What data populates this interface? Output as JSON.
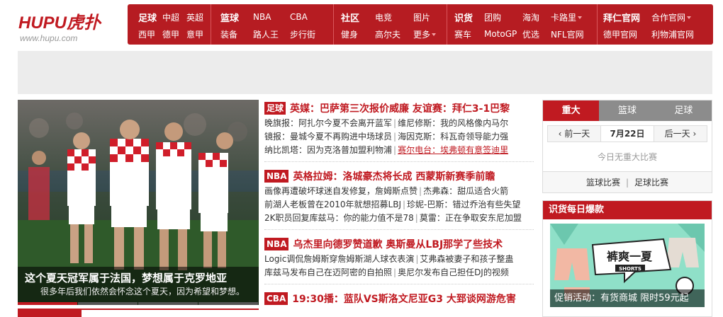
{
  "logo": {
    "main": "HUPU虎扑",
    "sub": "www.hupu.com"
  },
  "nav": {
    "groups": [
      {
        "row1": [
          "足球",
          "中超",
          "英超"
        ],
        "row2": [
          "西甲",
          "德甲",
          "意甲"
        ],
        "bold": "足球"
      },
      {
        "row1": [
          "篮球",
          "NBA",
          "CBA"
        ],
        "row2": [
          "装备",
          "路人王",
          "步行街"
        ],
        "bold": "篮球"
      },
      {
        "row1": [
          "社区",
          "电竞",
          "图片"
        ],
        "row2": [
          "健身",
          "高尔夫",
          "更多"
        ],
        "bold": "社区"
      },
      {
        "row1": [
          "识货",
          "团购",
          "海淘",
          "卡路里"
        ],
        "row2": [
          "赛车",
          "MotoGP",
          "优选",
          "NFL官网"
        ],
        "bold": "识货"
      },
      {
        "row1": [
          "拜仁官网",
          "合作官网"
        ],
        "row2": [
          "德甲官网",
          "利物浦官网"
        ],
        "bold": "拜仁官网"
      }
    ]
  },
  "hero": {
    "title": "这个夏天冠军属于法国，梦想属于克罗地亚",
    "subtitle": "很多年后我们依然会怀念这个夏天，因为希望和梦想。"
  },
  "news": [
    {
      "tag": "足球",
      "headline": "英媒：巴萨第三次报价威廉  友谊赛：拜仁3-1巴黎",
      "lines": [
        [
          "晚旗报：阿扎尔今夏不会离开蓝军",
          "维尼修斯：我的风格像内马尔"
        ],
        [
          "镜报：曼城今夏不再购进中场球员",
          "海因克斯：科瓦奇领导能力强"
        ],
        [
          "纳比凯塔：因为克洛普加盟利物浦",
          "赛尔电台：埃弗顿有意签迪里"
        ]
      ]
    },
    {
      "tag": "NBA",
      "headline": "英格拉姆：洛城豪杰将长成  西蒙斯新赛季前瞻",
      "lines": [
        [
          "画像再遭破坏球迷自发修复，詹姆斯点赞",
          "杰弗森：甜瓜适合火箭"
        ],
        [
          "前湖人老板曾在2010年就想招募LBJ",
          "珍妮-巴斯：错过乔治有些失望"
        ],
        [
          "2K职员回复库兹马：你的能力值不是78",
          "莫雷：正在争取安东尼加盟"
        ]
      ]
    },
    {
      "tag": "NBA",
      "headline": "乌杰里向德罗赞道歉  奥斯曼从LBJ那学了些技术",
      "lines": [
        [
          "Logic调侃詹姆斯穿詹姆斯湖人球衣表演",
          "艾弗森被妻子和孩子整蛊"
        ],
        [
          "库兹马发布自己在迈阿密的自拍照",
          "奥尼尔发布自己担任DJ的视频"
        ]
      ]
    },
    {
      "tag": "CBA",
      "headline": "19:30播：蓝队VS斯洛文尼亚G3  大郅谈网游危害",
      "lines": []
    }
  ],
  "schedule": {
    "tabs": [
      "重大",
      "篮球",
      "足球"
    ],
    "prev": "前一天",
    "date": "7月22日",
    "next": "后一天",
    "empty": "今日无重大比赛",
    "link_basketball": "篮球比赛",
    "link_football": "足球比赛"
  },
  "shop": {
    "title": "识货每日爆款",
    "promo_text": "裤爽一夏",
    "promo_sub": "SHORTS",
    "caption": "促销活动：有货商城 限时59元起"
  },
  "colors": {
    "brand": "#c01a21",
    "nav_bg": "#b61c22",
    "tab_inactive": "#8c8c8c",
    "shop_bg": "#8fe0c8"
  }
}
